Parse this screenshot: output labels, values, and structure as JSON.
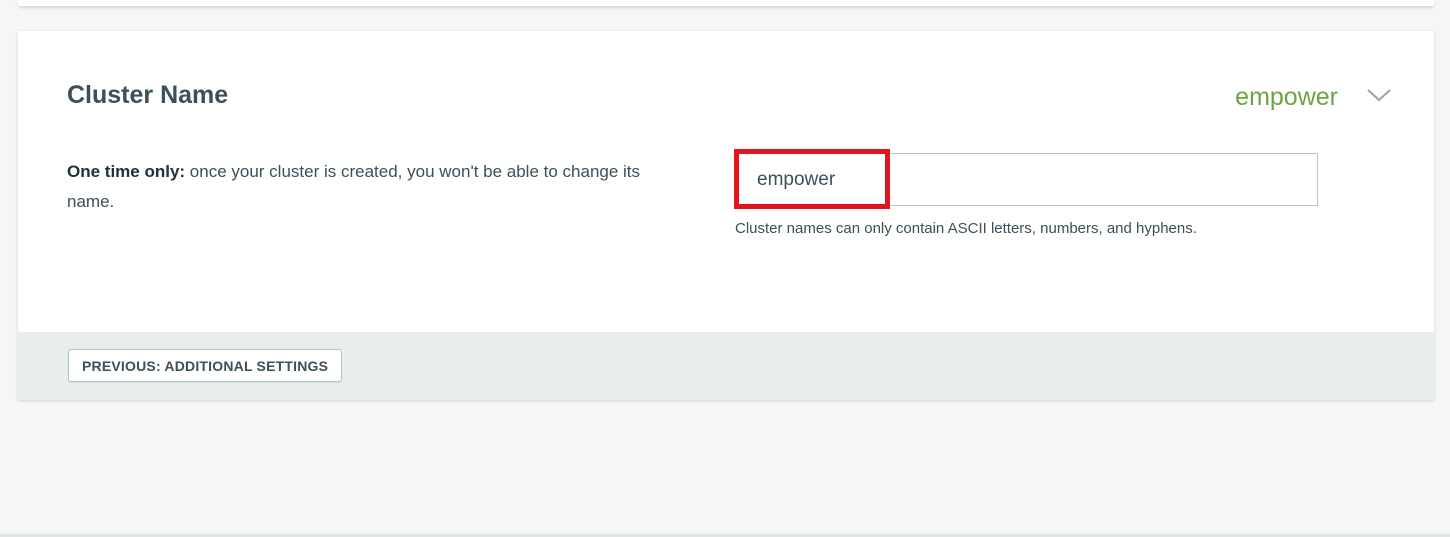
{
  "section": {
    "title": "Cluster Name",
    "summary_value": "empower",
    "chevron_icon": "chevron-down-icon"
  },
  "description": {
    "emphasis": "One time only:",
    "text": " once your cluster is created, you won't be able to change its name."
  },
  "cluster_name_input": {
    "value": "empower"
  },
  "hint": "Cluster names can only contain ASCII letters, numbers, and hyphens.",
  "footer": {
    "previous_button_label": "PREVIOUS: ADDITIONAL SETTINGS"
  },
  "colors": {
    "accent_green": "#6ba442",
    "highlight_red": "#e3141c"
  }
}
